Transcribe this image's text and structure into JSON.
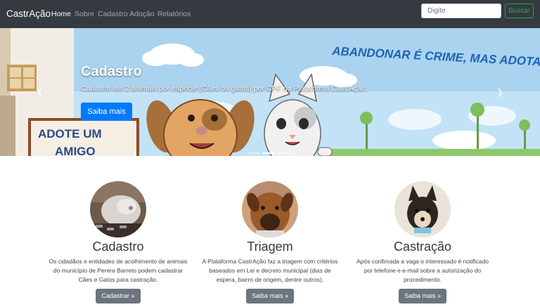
{
  "navbar": {
    "brand": "CastrAção",
    "links": [
      "Home",
      "Sobre",
      "Cadastro",
      "Adoção",
      "Relatórios"
    ],
    "active": "Home",
    "search_placeholder": "Digite",
    "search_button": "Buscar"
  },
  "carousel": {
    "title": "Cadastro",
    "text": "Cadastre até 2 animais por espécie (Cães ou gatos) por CPF na Plataforma CastrAção.",
    "button": "Saiba mais",
    "mural_text": "ABANDONAR É CRIME, MAS ADOTAR É UM A",
    "sign_text_1": "ADOTE UM",
    "sign_text_2": "AMIGO"
  },
  "features": [
    {
      "title": "Cadastro",
      "text": "Os cidadãos e entidades de acolhimento de animais do município de Perera Barreto podem cadastrar Cães e Gatos para castração.",
      "button": "Cadastrar »"
    },
    {
      "title": "Triagem",
      "text": "A Plataforma CastrAção faz a triagem com critérios baseados em Lei e decreto municipal (dias de espera, bairro de origem, dentre outros).",
      "button": "Saiba mais »"
    },
    {
      "title": "Castração",
      "text": "Após confimada a vaga o interessado é notificado por telefone e e-mail sobre a autorização do procedimento.",
      "button": "Saiba mais »"
    }
  ],
  "colors": {
    "navbar_bg": "#343a40",
    "primary": "#007bff",
    "success": "#28a745",
    "secondary": "#6c757d"
  }
}
